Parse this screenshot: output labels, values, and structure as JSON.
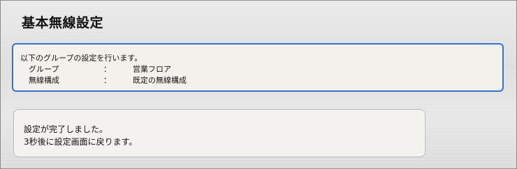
{
  "page": {
    "title": "基本無線設定"
  },
  "info": {
    "intro": "以下のグループの設定を行います。",
    "rows": [
      {
        "label": "グループ",
        "sep": "：",
        "value": "営業フロア"
      },
      {
        "label": "無線構成",
        "sep": "：",
        "value": "既定の無線構成"
      }
    ]
  },
  "status": {
    "line1": "設定が完了しました。",
    "line2": "3秒後に設定画面に戻ります。"
  },
  "colors": {
    "info_border": "#3a6fd4",
    "panel_bg": "#f2f1ec"
  }
}
